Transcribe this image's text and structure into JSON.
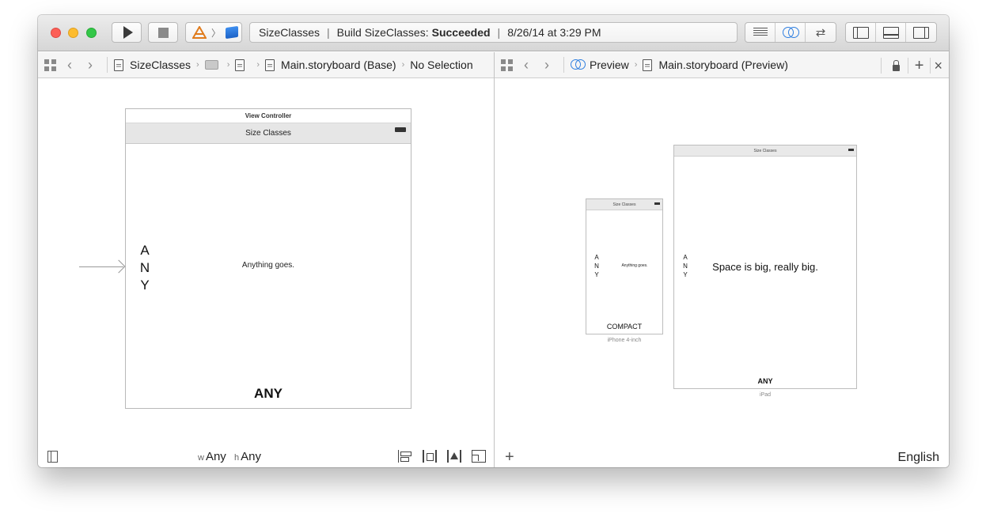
{
  "toolbar": {
    "activity": {
      "project": "SizeClasses",
      "build_prefix": "Build SizeClasses:",
      "build_status": "Succeeded",
      "timestamp": "8/26/14 at 3:29 PM",
      "separator": "|"
    }
  },
  "left_editor": {
    "jumpbar": {
      "crumbs": [
        "SizeClasses",
        "Main.storyboard (Base)",
        "No Selection"
      ],
      "back_glyph": "‹",
      "forward_glyph": "›",
      "crumb_separator": "›"
    },
    "scene": {
      "title": "View Controller",
      "nav_title": "Size Classes",
      "vertical_text": "ANY",
      "body_label": "Anything goes.",
      "bottom_label": "ANY"
    },
    "bottombar": {
      "width_key": "w",
      "width_value": "Any",
      "height_key": "h",
      "height_value": "Any"
    }
  },
  "right_editor": {
    "jumpbar": {
      "crumbs": [
        "Preview",
        "Main.storyboard (Preview)"
      ],
      "plus_glyph": "+",
      "close_glyph": "×"
    },
    "devices": [
      {
        "name": "iPhone 4-inch",
        "nav_title": "Size Classes",
        "vertical_text": "ANY",
        "body_label": "Anything goes.",
        "bottom_label": "COMPACT"
      },
      {
        "name": "iPad",
        "nav_title": "Size Classes",
        "vertical_text": "ANY",
        "body_label": "Space is big, really big.",
        "bottom_label": "ANY"
      }
    ],
    "bottombar": {
      "add_glyph": "+",
      "language": "English"
    }
  },
  "colors": {
    "close": "#fc5f57",
    "minimize": "#fdbc2e",
    "zoom": "#33c748",
    "accent": "#2f7fe0"
  }
}
